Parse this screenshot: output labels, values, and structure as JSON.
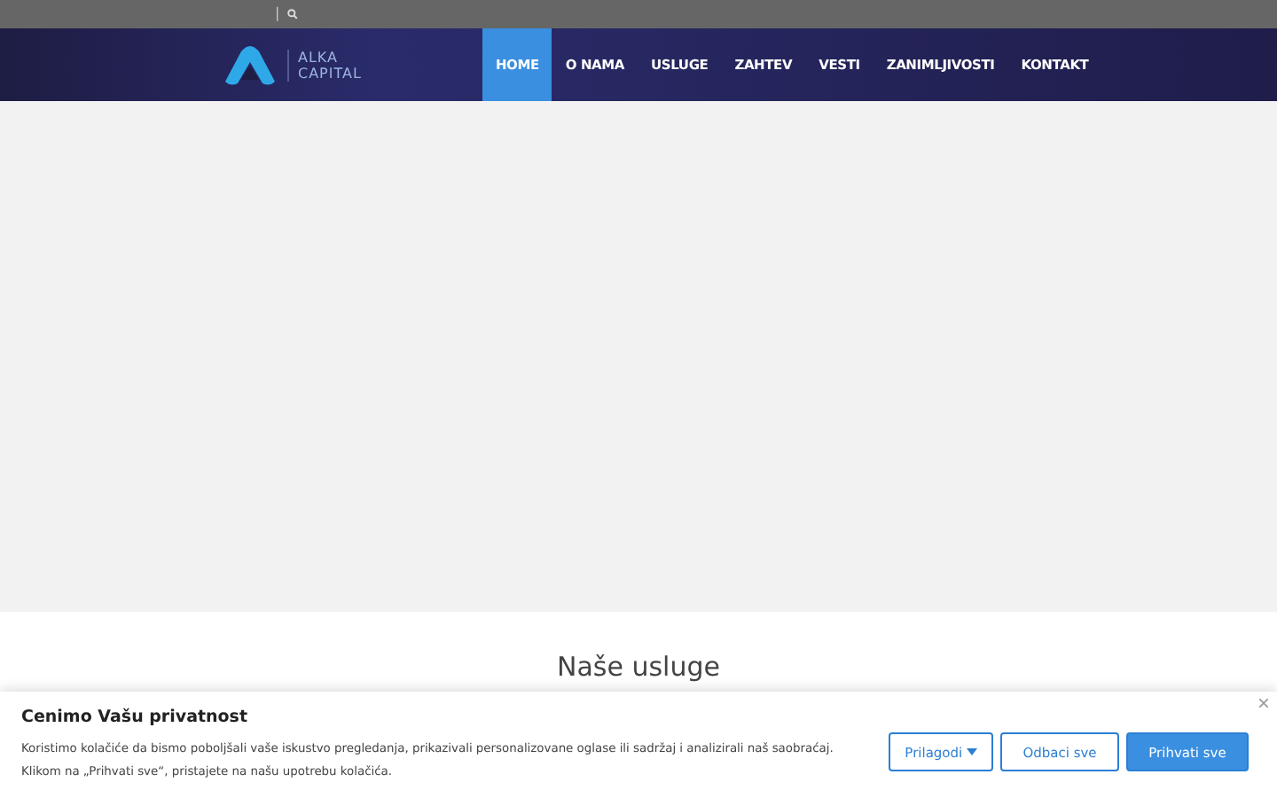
{
  "topbar": {
    "divider": "|"
  },
  "logo": {
    "line1": "ALKA",
    "line2": "CAPITAL"
  },
  "nav": [
    {
      "label": "HOME",
      "selected": true
    },
    {
      "label": "O NAMA",
      "selected": false
    },
    {
      "label": "USLUGE",
      "selected": false
    },
    {
      "label": "ZAHTEV",
      "selected": false
    },
    {
      "label": "VESTI",
      "selected": false
    },
    {
      "label": "ZANIMLJIVOSTI",
      "selected": false
    },
    {
      "label": "KONTAKT",
      "selected": false
    }
  ],
  "section": {
    "heading": "Naše usluge"
  },
  "cookie_banner": {
    "title": "Cenimo Vašu privatnost",
    "text": "Koristimo kolačiće da bismo poboljšali vaše iskustvo pregledanja, prikazivali personalizovane oglase ili sadržaj i analizirali naš saobraćaj. Klikom na „Prihvati sve“, pristajete na našu upotrebu kolačića.",
    "buttons": [
      {
        "label": "Prilagodi",
        "kind": "dropdown"
      },
      {
        "label": "Odbaci sve",
        "kind": "outline"
      },
      {
        "label": "Prihvati sve",
        "kind": "primary"
      }
    ]
  }
}
